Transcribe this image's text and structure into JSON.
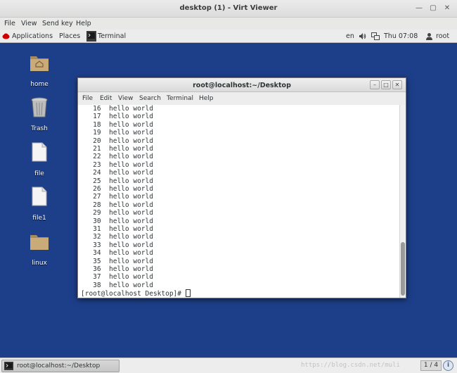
{
  "host": {
    "title": "desktop (1) - Virt Viewer",
    "menu": [
      "File",
      "View",
      "Send key",
      "Help"
    ]
  },
  "panel": {
    "applications": "Applications",
    "places": "Places",
    "terminal_tab": "Terminal",
    "lang": "en",
    "clock": "Thu 07:08",
    "user": "root"
  },
  "desktop_icons": [
    {
      "label": "home",
      "icon": "folder-home-icon"
    },
    {
      "label": "Trash",
      "icon": "trash-icon"
    },
    {
      "label": "file",
      "icon": "file-icon"
    },
    {
      "label": "file1",
      "icon": "file-icon"
    },
    {
      "label": "linux",
      "icon": "folder-icon"
    }
  ],
  "terminal": {
    "title": "root@localhost:~/Desktop",
    "menu": [
      "File",
      "Edit",
      "View",
      "Search",
      "Terminal",
      "Help"
    ],
    "lines": [
      "   16  hello world",
      "   17  hello world",
      "   18  hello world",
      "   19  hello world",
      "   20  hello world",
      "   21  hello world",
      "   22  hello world",
      "   23  hello world",
      "   24  hello world",
      "   25  hello world",
      "   26  hello world",
      "   27  hello world",
      "   28  hello world",
      "   29  hello world",
      "   30  hello world",
      "   31  hello world",
      "   32  hello world",
      "   33  hello world",
      "   34  hello world",
      "   35  hello world",
      "   36  hello world",
      "   37  hello world",
      "   38  hello world"
    ],
    "prompt": "[root@localhost Desktop]# "
  },
  "taskbar": {
    "task_label": "root@localhost:~/Desktop",
    "watermark": "https://blog.csdn.net/muli",
    "pager": "1 / 4"
  },
  "colors": {
    "desktop_bg": "#1d3f8a",
    "panel_bg": "#ececec"
  }
}
